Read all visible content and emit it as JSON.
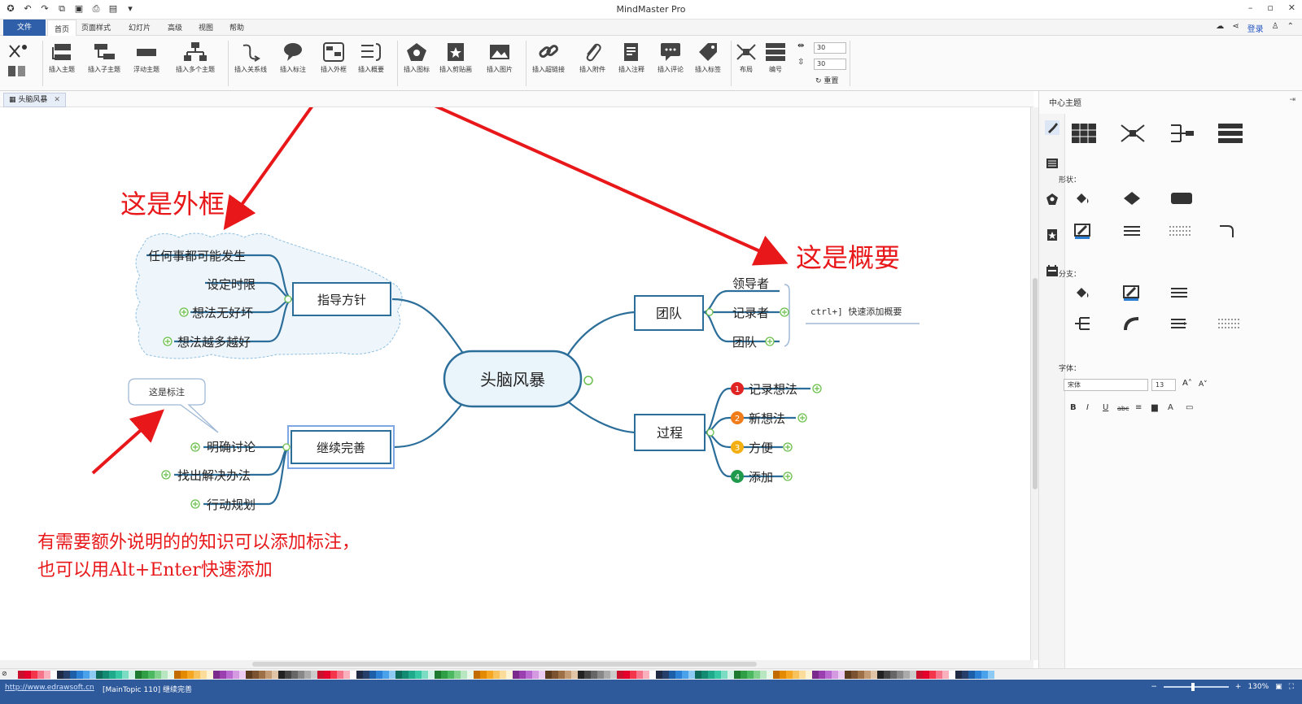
{
  "window": {
    "title": "MindMaster Pro",
    "controls": [
      "–",
      "▫",
      "✕"
    ]
  },
  "menu": {
    "file": "文件",
    "tabs": [
      "首页",
      "页面样式",
      "幻灯片",
      "高级",
      "视图",
      "帮助"
    ],
    "active_tab": "首页",
    "login": "登录"
  },
  "ribbon": {
    "buttons": [
      "插入主题",
      "插入子主题",
      "浮动主题",
      "插入多个主题",
      "插入关系线",
      "插入标注",
      "插入外框",
      "插入概要",
      "插入图标",
      "插入剪贴画",
      "插入图片",
      "插入超链接",
      "插入附件",
      "插入注释",
      "插入评论",
      "插入标签",
      "布局",
      "编号"
    ],
    "spin_h": "30",
    "spin_v": "30",
    "reset": "重置"
  },
  "document": {
    "tab": "头脑风暴"
  },
  "mindmap": {
    "central": "头脑风暴",
    "left_branches": [
      {
        "label": "指导方针",
        "children": [
          "任何事都可能发生",
          "设定时限",
          "想法无好坏",
          "想法越多越好"
        ]
      },
      {
        "label": "继续完善",
        "children": [
          "明确讨论",
          "找出解决办法",
          "行动规划"
        ]
      }
    ],
    "right_branches": [
      {
        "label": "团队",
        "children": [
          "领导者",
          "记录者",
          "团队"
        ]
      },
      {
        "label": "过程",
        "children": [
          "记录想法",
          "新想法",
          "方便",
          "添加"
        ]
      }
    ],
    "summary_hint": "ctrl+] 快速添加概要",
    "callout": "这是标注",
    "numbers": [
      "1",
      "2",
      "3",
      "4"
    ]
  },
  "annotations": {
    "boundary": "这是外框",
    "summary": "这是概要",
    "note_line1": "有需要额外说明的的知识可以添加标注，",
    "note_line2": "也可以用Alt+Enter快速添加"
  },
  "right_panel": {
    "title": "中心主题",
    "shape_label": "形状：",
    "branch_label": "分支：",
    "font_label": "字体：",
    "font_name": "宋体",
    "font_size": "13",
    "font_buttons": [
      "B",
      "I",
      "U",
      "abc"
    ]
  },
  "status": {
    "url": "http://www.edrawsoft.cn",
    "topic": "[MainTopic 110]  继续完善",
    "zoom": "130%",
    "zoom_fraction": 0.45
  },
  "colors": {
    "accent_blue": "#2e5a9c",
    "branch_line": "#2c6e9a",
    "annotation_red": "#e8181a",
    "boundary_fill": "#eef6fc",
    "num1": "#e02323",
    "num2": "#f07c1a",
    "num3": "#f4b013",
    "num4": "#1f9a4c"
  }
}
